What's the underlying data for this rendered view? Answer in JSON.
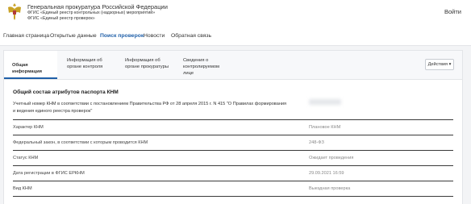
{
  "header": {
    "org_title": "Генеральная прокуратура Российской Федерации",
    "system_name": "ФГИС «Единый реестр контрольных (надзорных) мероприятий»",
    "system_subname": "ФГИС «Единый реестр проверок»",
    "login_label": "Войти",
    "emblem_icon": "coat-of-arms-icon"
  },
  "nav": {
    "items": [
      {
        "label": "Главная страница"
      },
      {
        "label": "Открытые данные"
      },
      {
        "label": "Поиск проверок"
      },
      {
        "label": "Новости"
      },
      {
        "label": "Обратная связь"
      }
    ],
    "active_index": 2
  },
  "tabs": [
    {
      "label": "Общая информация"
    },
    {
      "label": "Информация об органе контроля"
    },
    {
      "label": "Информация об органе прокуратуры"
    },
    {
      "label": "Сведения о контролируемом лице"
    }
  ],
  "actions_label": "Действия ▾",
  "section": {
    "title": "Общий состав атрибутов паспорта КНМ",
    "description": "Учетный номер КНМ в соответствии с постановлением Правительства РФ от 28 апреля 2015 г. N 415 \"О Правилах формирования и ведения единого реестра проверок\""
  },
  "attributes": [
    {
      "key": "Характер КНМ",
      "value": "Плановое КНМ"
    },
    {
      "key": "Федеральный закон, в соответствии с которым проводится КНМ",
      "value": "248-ФЗ"
    },
    {
      "key": "Статус КНМ",
      "value": "Ожидает проведения"
    },
    {
      "key": "Дата регистрации в ФГИС ЕРКНМ",
      "value": "29.09.2021 16:59"
    },
    {
      "key": "Вид КНМ",
      "value": "Выездная проверка"
    }
  ],
  "colors": {
    "accent": "#1f5fa8",
    "background": "#f3f4f6"
  }
}
